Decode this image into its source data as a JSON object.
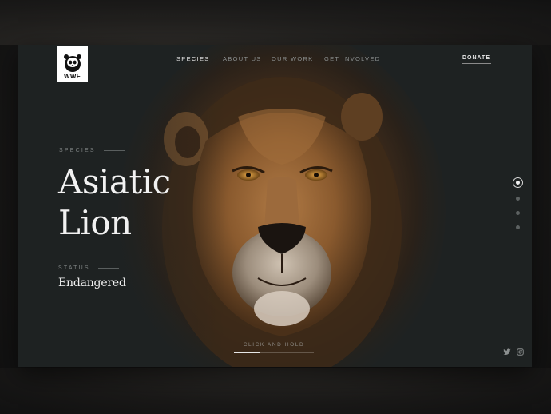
{
  "brand": {
    "logo_text": "WWF",
    "logo_icon": "panda-icon"
  },
  "nav": {
    "items": [
      {
        "label": "SPECIES",
        "active": true
      },
      {
        "label": "ABOUT US",
        "active": false
      },
      {
        "label": "OUR WORK",
        "active": false
      },
      {
        "label": "GET INVOLVED",
        "active": false
      }
    ],
    "donate_label": "DONATE"
  },
  "hero": {
    "eyebrow": "SPECIES",
    "title_line1": "Asiatic",
    "title_line2": "Lion",
    "status_label": "STATUS",
    "status_value": "Endangered",
    "hold_label": "CLICK AND HOLD",
    "hold_progress": 0.32
  },
  "pager": {
    "count": 4,
    "active_index": 0
  },
  "social": {
    "icons": [
      "twitter-icon",
      "instagram-icon"
    ]
  },
  "colors": {
    "frame_bg": "#1e2222",
    "text_primary": "#f2f2f2",
    "text_muted": "#7f8484",
    "fur_accent": "#8a5a2b"
  }
}
